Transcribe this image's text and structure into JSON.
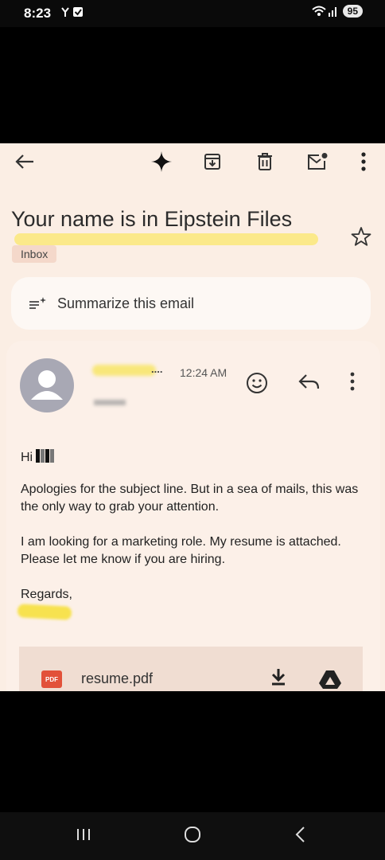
{
  "status_bar": {
    "time": "8:23",
    "battery": "95"
  },
  "toolbar": {
    "icons": [
      "back-arrow-icon",
      "gemini-sparkle-icon",
      "archive-icon",
      "delete-icon",
      "mark-unread-icon",
      "more-vert-icon"
    ]
  },
  "email": {
    "subject": "Your name is in Eipstein Files",
    "label": "Inbox",
    "summarize_label": "Summarize this email",
    "sender_ellipsis": "....",
    "time": "12:24 AM",
    "greeting": "Hi",
    "paragraph1": "Apologies for the subject line. But in a sea of mails, this was the only way to grab your attention.",
    "paragraph2": "I am looking for a marketing role. My resume is attached. Please let me know if you are hiring.",
    "signoff": "Regards,",
    "attachment": {
      "filename": "resume.pdf",
      "type_badge": "PDF"
    }
  },
  "colors": {
    "background": "#fbeee4",
    "highlight": "#fbe98a",
    "pdf": "#e2513a"
  }
}
